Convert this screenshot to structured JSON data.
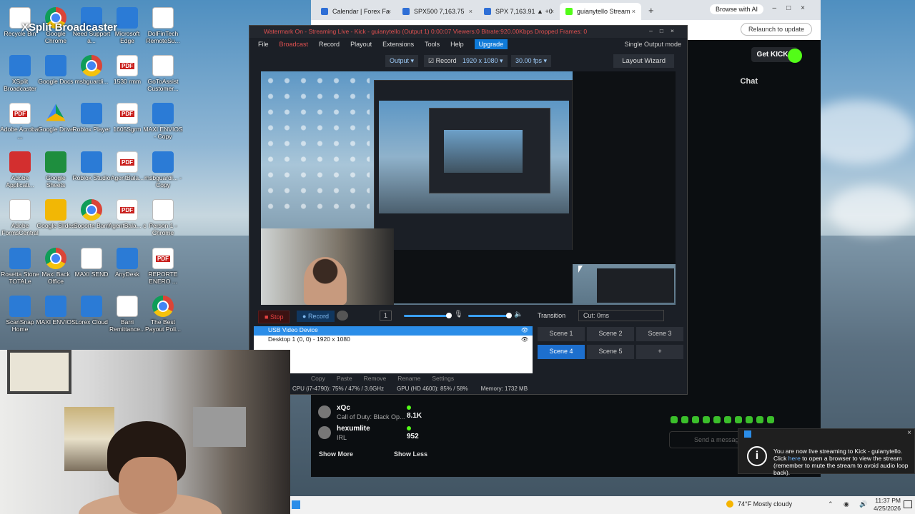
{
  "xsplit_overlay_text": "XSplit Broadcaster",
  "desktop_icons": [
    {
      "label": "Recycle Bin",
      "icon": "recycle-bin-icon",
      "kind": "doc"
    },
    {
      "label": "Google Chrome",
      "icon": "chrome-icon",
      "kind": "chrome"
    },
    {
      "label": "Need Support a...",
      "icon": "help-icon",
      "kind": "blue"
    },
    {
      "label": "Microsoft Edge",
      "icon": "edge-icon",
      "kind": "blue"
    },
    {
      "label": "DolFinTech RemoteSu...",
      "icon": "document-icon",
      "kind": "doc"
    },
    {
      "label": "XSplit Broadcaster",
      "icon": "xsplit-icon",
      "kind": "blue"
    },
    {
      "label": "Google Docs",
      "icon": "google-docs-icon",
      "kind": "blue"
    },
    {
      "label": "msbguardi...",
      "icon": "chrome-icon",
      "kind": "chrome"
    },
    {
      "label": "1530 rmm",
      "icon": "pdf-icon",
      "kind": "pdf"
    },
    {
      "label": "GoToAssist Customer...",
      "icon": "document-icon",
      "kind": "doc"
    },
    {
      "label": "Adobe Acrobat ...",
      "icon": "acrobat-icon",
      "kind": "pdf"
    },
    {
      "label": "Google Drive",
      "icon": "google-drive-icon",
      "kind": "gdrive"
    },
    {
      "label": "Roblox Player",
      "icon": "roblox-icon",
      "kind": "blue"
    },
    {
      "label": "1605Sgrm",
      "icon": "pdf-icon",
      "kind": "pdf"
    },
    {
      "label": "MAXI ENVIOS - Copy",
      "icon": "edge-icon",
      "kind": "blue"
    },
    {
      "label": "Adobe Applicati...",
      "icon": "adobe-icon",
      "kind": "red"
    },
    {
      "label": "Google Sheets",
      "icon": "google-sheets-icon",
      "kind": "green"
    },
    {
      "label": "Roblox Studio",
      "icon": "roblox-studio-icon",
      "kind": "blue"
    },
    {
      "label": "AgentBala...",
      "icon": "pdf-icon",
      "kind": "pdf"
    },
    {
      "label": "msbguardi... - Copy",
      "icon": "edge-icon",
      "kind": "blue"
    },
    {
      "label": "Adobe FormsCentral",
      "icon": "adobe-forms-icon",
      "kind": "doc"
    },
    {
      "label": "Google Slides",
      "icon": "google-slides-icon",
      "kind": "yellow"
    },
    {
      "label": "Soporte Barri",
      "icon": "chrome-icon",
      "kind": "chrome"
    },
    {
      "label": "AgentBala... c",
      "icon": "pdf-icon",
      "kind": "pdf"
    },
    {
      "label": "Person 1 - Chrome",
      "icon": "document-icon",
      "kind": "doc"
    },
    {
      "label": "Rosetta Stone TOTALe",
      "icon": "rosetta-icon",
      "kind": "blue"
    },
    {
      "label": "Maxi Back Office",
      "icon": "chrome-icon",
      "kind": "chrome"
    },
    {
      "label": "MAXI SEND",
      "icon": "document-icon",
      "kind": "doc"
    },
    {
      "label": "AnyDesk",
      "icon": "anydesk-icon",
      "kind": "blue"
    },
    {
      "label": "REPORTE ENERO ...",
      "icon": "pdf-icon",
      "kind": "pdf"
    },
    {
      "label": "ScanSnap Home",
      "icon": "scansnap-icon",
      "kind": "blue"
    },
    {
      "label": "MAXI ENVIOS",
      "icon": "edge-icon",
      "kind": "blue"
    },
    {
      "label": "Lorex Cloud",
      "icon": "lorex-icon",
      "kind": "blue"
    },
    {
      "label": "Barri Remittance...",
      "icon": "document-icon",
      "kind": "doc"
    },
    {
      "label": "The Best Payout Poli...",
      "icon": "chrome-icon",
      "kind": "chrome"
    }
  ],
  "browser": {
    "tabs": [
      {
        "label": "Calendar | Forex Fa",
        "active": false
      },
      {
        "label": "SPX500 7,163.75",
        "active": false
      },
      {
        "label": "SPX 7,163.91 ▲ +0",
        "active": false
      },
      {
        "label": "guianytello Stream",
        "active": true
      }
    ],
    "new_tab": "+",
    "browse_ai": "Browse with AI",
    "relaunch": "Relaunch to update",
    "get_kicks": "Get KICKs",
    "chat_label": "Chat",
    "send_placeholder": "Send a message",
    "streamers": [
      {
        "name": "xQc",
        "game": "Call of Duty: Black Op...",
        "viewers": "8.1K"
      },
      {
        "name": "hexumlite",
        "game": "IRL",
        "viewers": "952"
      }
    ],
    "show_more": "Show More",
    "show_less": "Show Less"
  },
  "xsplit": {
    "title": "Watermark On - Streaming Live - Kick - guianytello (Output 1) 0:00:07  Viewers:0  Bitrate:920.00Kbps  Dropped Frames: 0",
    "menu": [
      "File",
      "Broadcast",
      "Record",
      "Playout",
      "Extensions",
      "Tools",
      "Help"
    ],
    "upgrade": "Upgrade",
    "single_output_mode": "Single Output mode",
    "output_label": "Output",
    "record_label": "Record",
    "resolution": "1920 x 1080",
    "fps": "30.00 fps",
    "layout_wizard": "Layout Wizard",
    "stop": "Stop",
    "record_btn": "Record",
    "scene_number": "1",
    "transition": "Transition",
    "cut": "Cut: 0ms",
    "sources": [
      {
        "label": "USB Video Device",
        "selected": true
      },
      {
        "label": "Desktop 1 (0, 0) - 1920 x 1080",
        "selected": false
      }
    ],
    "source_toolbar": [
      "Copy",
      "Paste",
      "Remove",
      "Rename",
      "Settings"
    ],
    "status": {
      "cpu": "CPU (i7-4790):  75% / 47% / 3.6GHz",
      "gpu": "GPU (HD 4600):  85% / 58%",
      "memory": "Memory:  1732 MB"
    },
    "scenes": [
      {
        "label": "Scene 1",
        "active": false
      },
      {
        "label": "Scene 2",
        "active": false
      },
      {
        "label": "Scene 3",
        "active": false
      },
      {
        "label": "Scene 4",
        "active": true
      },
      {
        "label": "Scene 5",
        "active": false
      },
      {
        "label": "+",
        "active": false
      }
    ]
  },
  "toast": {
    "line1": "You are now live streaming to Kick - guianytello. Click ",
    "link": "here",
    "line2": " to open a browser to view the stream (remember to mute the stream to avoid audio loop back)."
  },
  "taskbar": {
    "weather": "74°F  Mostly cloudy",
    "time": "11:37 PM",
    "date": "4/25/2026"
  }
}
